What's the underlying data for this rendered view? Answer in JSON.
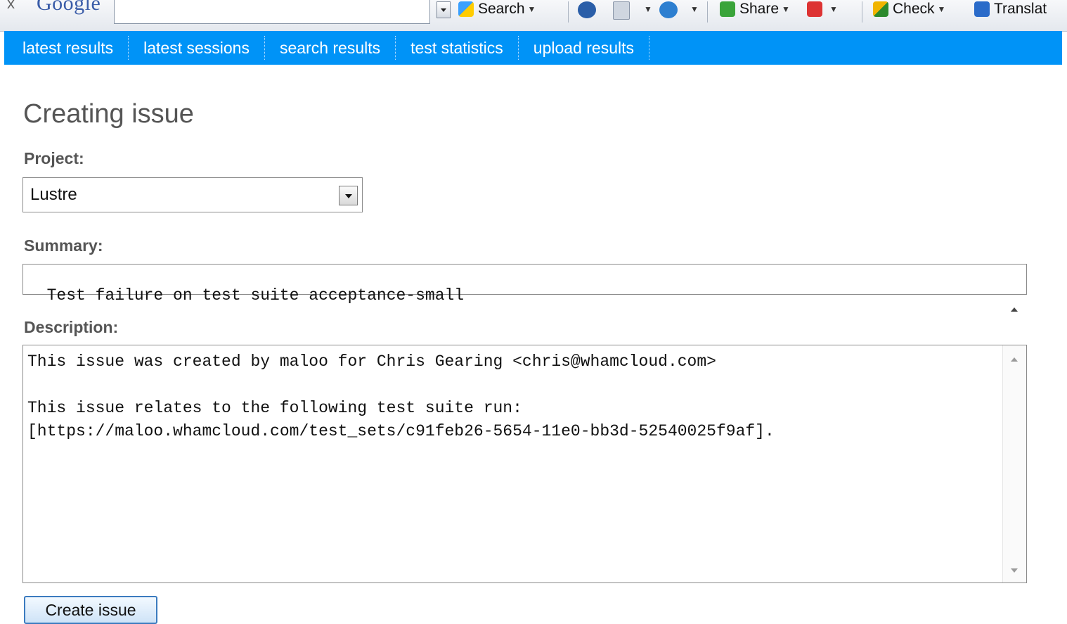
{
  "toolbar": {
    "close": "x",
    "brand": "Google",
    "search_label": "Search",
    "share_label": "Share",
    "check_label": "Check",
    "translate_label": "Translat"
  },
  "nav": {
    "items": [
      "latest results",
      "latest sessions",
      "search results",
      "test statistics",
      "upload results"
    ]
  },
  "page": {
    "title": "Creating issue"
  },
  "form": {
    "project_label": "Project:",
    "project_value": "Lustre",
    "summary_label": "Summary:",
    "summary_value": "Test failure on test suite acceptance-small",
    "description_label": "Description:",
    "description_lines": [
      "This issue was created by maloo for Chris Gearing <chris@whamcloud.com>",
      "",
      "This issue relates to the following test suite run:",
      "[https://maloo.whamcloud.com/test_sets/c91feb26-5654-11e0-bb3d-52540025f9af]."
    ],
    "submit_label": "Create issue"
  },
  "colors": {
    "nav_bg": "#0093f7",
    "nav_text": "#ffffff",
    "button_border": "#3b7bbf"
  }
}
